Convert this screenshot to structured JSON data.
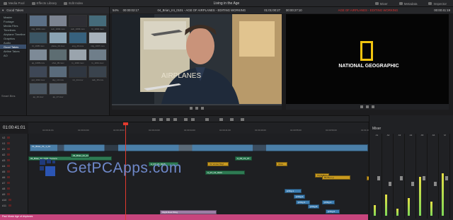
{
  "topbar": {
    "media_pool": "Media Pool",
    "effects_library": "Effects Library",
    "edit_index": "Edit Index",
    "title": "Living in the Age",
    "mixer": "Mixer",
    "metadata": "Metadata",
    "inspector": "Inspector"
  },
  "media_pool": {
    "header": "Good Takes",
    "bins": [
      "Master",
      "Footage",
      "Media Files",
      "Timelines",
      "Airplane Timeline",
      "Graphics",
      "Audio",
      "Good Takes",
      "Airline Takes",
      "AO"
    ],
    "smart_bins": "Smart Bins",
    "thumbs": [
      {
        "label": "mlg_1001.mov",
        "color": "#5b6f86"
      },
      {
        "label": "sub_1002.mov",
        "color": "#7c8390"
      },
      {
        "label": "sub_1003.mov",
        "color": "#2e2e34"
      },
      {
        "label": "bl_1004.mov",
        "color": "#456b7a"
      },
      {
        "label": "bl_1005.mov",
        "color": "#3b5564"
      },
      {
        "label": "plane_04.mov",
        "color": "#8aa3b4"
      },
      {
        "label": "eng_20.mov",
        "color": "#37617d"
      },
      {
        "label": "mlg_1007.mov",
        "color": "#a8b3bc"
      },
      {
        "label": "ap_1008.mov",
        "color": "#7d8a97"
      },
      {
        "label": "shot_09.mov",
        "color": "#5d6d72"
      },
      {
        "label": "tx_1010.mov",
        "color": "#9aa4ad"
      },
      {
        "label": "tx_1011.mov",
        "color": "#6f7e8a"
      },
      {
        "label": "ppl_1012.mov",
        "color": "#3e4756"
      },
      {
        "label": "sky_13.mov",
        "color": "#5a6b7b"
      },
      {
        "label": "int_14.mov",
        "color": "#2f3640"
      },
      {
        "label": "cab_15.mov",
        "color": "#3a434d"
      },
      {
        "label": "ap_16.mov",
        "color": "#4a5560"
      },
      {
        "label": "ap_17.mov",
        "color": "#555f69"
      }
    ]
  },
  "source": {
    "left_tc": "00:00:02:17",
    "clip_name": "04_Brian_Int_0101 - AGE OF AIRPLANES - EDITING WORKING",
    "right_tc": "01:01:00:27",
    "zoom": "54%"
  },
  "program": {
    "left_tc": "00:00:27:10",
    "name": "AGE OF AIRPLANES - EDITING WORKING",
    "right_tc": "00:00:41:19",
    "zoom": "54%",
    "logo_text": "NATIONAL GEOGRAPHIC",
    "logo_color": "#f1c40f"
  },
  "timeline": {
    "timecode": "01:00:41:01",
    "ruler": [
      "01:00:41:01",
      "01:00:04:00",
      "01:00:18:00",
      "01:00:24:00",
      "01:00:34:00",
      "01:00:41:00",
      "01:00:49:00",
      "01:00:55:00",
      "01:00:59:00",
      "01:01:03:00"
    ],
    "tracks": [
      "V2",
      "V1",
      "A1",
      "A2",
      "A3",
      "A4",
      "A5",
      "A6",
      "A7",
      "A8",
      "A9",
      "A10",
      "A11"
    ],
    "video_title": "Video 1",
    "clips": [
      {
        "label": "V1_Brian_V1_1_04",
        "cls": "v"
      },
      {
        "label": "04_Brian_Int_0101_Camera",
        "cls": "g"
      },
      {
        "label": "04_Brian_Int_0101",
        "cls": "g"
      },
      {
        "label": "A_07_V1_0015",
        "cls": "g"
      },
      {
        "label": "V1 Vomiel Skyl",
        "cls": "o"
      },
      {
        "label": "A_09_V1_07",
        "cls": "g"
      },
      {
        "label": "Glow",
        "cls": "o"
      },
      {
        "label": "A_07_V1_0123",
        "cls": "g"
      },
      {
        "label": "Flight Bag",
        "cls": "o"
      },
      {
        "label": "Bb Bus Lp",
        "cls": "o"
      },
      {
        "label": "Al Iberia",
        "cls": "o"
      },
      {
        "label": "pf fbg 1",
        "cls": "b"
      },
      {
        "label": "pf fbg 2",
        "cls": "b"
      },
      {
        "label": "pf fbg 3",
        "cls": "b"
      },
      {
        "label": "pf fbg 4",
        "cls": "b"
      },
      {
        "label": "pf fbg 5",
        "cls": "b"
      },
      {
        "label": "pf fbg 6",
        "cls": "b"
      },
      {
        "label": "Flight Reel Wing",
        "cls": "lv"
      },
      {
        "label": "Paul Music Age of Airplanes",
        "cls": "p"
      }
    ]
  },
  "mixer": {
    "title": "Mixer",
    "channels": [
      "A1",
      "A2",
      "A3",
      "A4",
      "A5",
      "A6",
      "M"
    ],
    "levels": [
      0.15,
      0.3,
      0.1,
      0.25,
      0.55,
      0.2,
      0.6
    ]
  },
  "watermark": {
    "text": "GetPCApps.com"
  }
}
